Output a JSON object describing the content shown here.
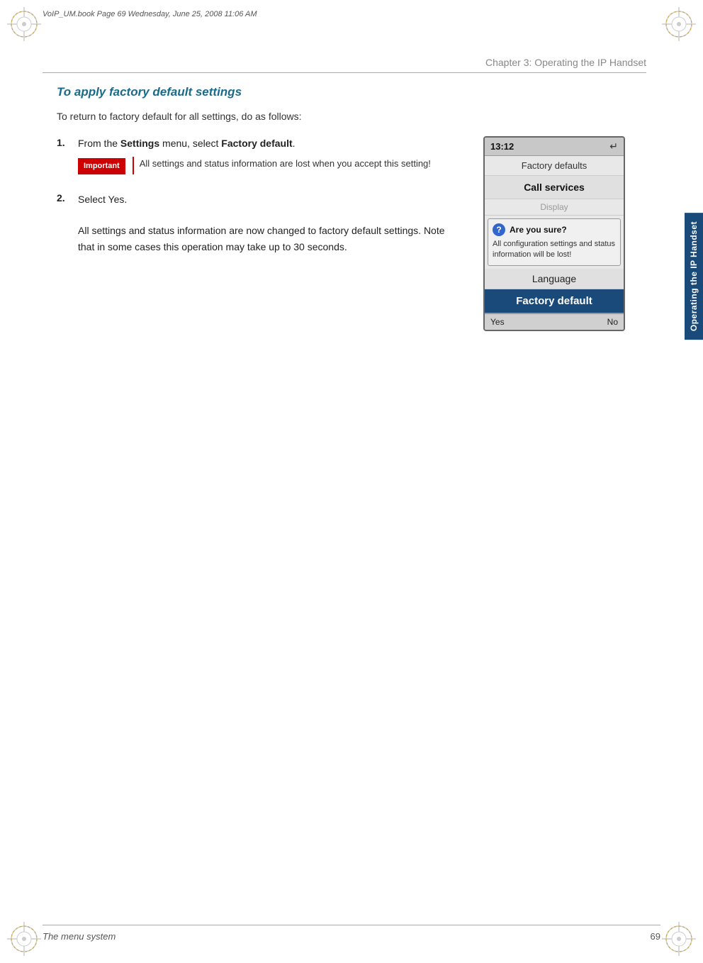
{
  "file_info": "VoIP_UM.book  Page 69  Wednesday, June 25, 2008  11:06 AM",
  "chapter_header": "Chapter 3:  Operating the IP Handset",
  "section_heading": "To apply factory default settings",
  "intro_text": "To return to factory default for all settings, do as follows:",
  "step1": {
    "number": "1.",
    "text_part1": "From the ",
    "bold1": "Settings",
    "text_part2": " menu, select ",
    "bold2": "Factory default",
    "text_part3": "."
  },
  "important_label": "Important",
  "important_text": "All settings and status information are lost when you accept this setting!",
  "step2": {
    "number": "2.",
    "text_part1": "Select ",
    "bold1": "Yes",
    "text_part2": ".",
    "description": "All settings and status information are now changed to factory default settings. Note that in some cases this operation may take up to 30 seconds."
  },
  "phone": {
    "time": "13:12",
    "icon": "↵",
    "menu_items": [
      {
        "label": "Factory defaults",
        "type": "normal"
      },
      {
        "label": "Call services",
        "type": "normal"
      },
      {
        "label": "Display",
        "type": "faded"
      }
    ],
    "dialog": {
      "title": "Are you sure?",
      "body": "All configuration settings and status information will be lost!"
    },
    "language_item": "Language",
    "factory_default_item": "Factory default",
    "bottom_yes": "Yes",
    "bottom_no": "No"
  },
  "sidebar_tab": "Operating the IP Handset",
  "footer_left": "The menu system",
  "footer_right": "69"
}
